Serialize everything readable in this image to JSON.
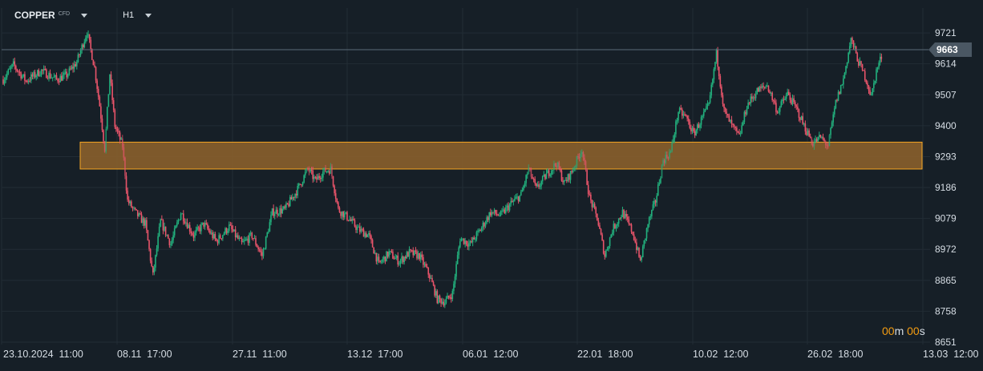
{
  "header": {
    "symbol": "COPPER",
    "symbol_type": "CFD",
    "timeframe": "H1"
  },
  "timer": {
    "minutes": "00",
    "m_unit": "m",
    "seconds": "00",
    "s_unit": "s"
  },
  "colors": {
    "background": "#161f27",
    "up": "#22b07d",
    "down": "#e8546a",
    "zone_fill": "#8a5f2c",
    "zone_border": "#f5a623",
    "price_line": "#5b6b78",
    "timer": "#f39c12"
  },
  "chart_data": {
    "type": "candlestick",
    "y_ticks": [
      9721,
      9614,
      9507,
      9400,
      9293,
      9186,
      9079,
      8972,
      8865,
      8758,
      8651
    ],
    "ylim": [
      8651,
      9755
    ],
    "x_tick_labels": [
      "23.10.2024  11:00",
      "08.11  17:00",
      "27.11  11:00",
      "13.12  17:00",
      "06.01  12:00",
      "22.01  18:00",
      "10.02  12:00",
      "26.02  18:00",
      "13.03  12:00"
    ],
    "current_price": 9663,
    "zone": {
      "low": 9250,
      "high": 9343
    },
    "price_path": [
      {
        "i": 0,
        "p": 9560
      },
      {
        "i": 8,
        "p": 9610
      },
      {
        "i": 18,
        "p": 9555
      },
      {
        "i": 30,
        "p": 9590
      },
      {
        "i": 42,
        "p": 9560
      },
      {
        "i": 50,
        "p": 9575
      },
      {
        "i": 58,
        "p": 9620
      },
      {
        "i": 66,
        "p": 9725
      },
      {
        "i": 72,
        "p": 9600
      },
      {
        "i": 76,
        "p": 9470
      },
      {
        "i": 80,
        "p": 9320
      },
      {
        "i": 84,
        "p": 9580
      },
      {
        "i": 88,
        "p": 9400
      },
      {
        "i": 94,
        "p": 9330
      },
      {
        "i": 98,
        "p": 9140
      },
      {
        "i": 104,
        "p": 9100
      },
      {
        "i": 112,
        "p": 9060
      },
      {
        "i": 118,
        "p": 8880
      },
      {
        "i": 124,
        "p": 9070
      },
      {
        "i": 132,
        "p": 8990
      },
      {
        "i": 140,
        "p": 9100
      },
      {
        "i": 150,
        "p": 9020
      },
      {
        "i": 158,
        "p": 9060
      },
      {
        "i": 168,
        "p": 9000
      },
      {
        "i": 178,
        "p": 9050
      },
      {
        "i": 188,
        "p": 8990
      },
      {
        "i": 196,
        "p": 9020
      },
      {
        "i": 204,
        "p": 8950
      },
      {
        "i": 212,
        "p": 9100
      },
      {
        "i": 222,
        "p": 9110
      },
      {
        "i": 232,
        "p": 9180
      },
      {
        "i": 240,
        "p": 9250
      },
      {
        "i": 246,
        "p": 9210
      },
      {
        "i": 252,
        "p": 9240
      },
      {
        "i": 258,
        "p": 9250
      },
      {
        "i": 264,
        "p": 9110
      },
      {
        "i": 272,
        "p": 9080
      },
      {
        "i": 280,
        "p": 9040
      },
      {
        "i": 288,
        "p": 9020
      },
      {
        "i": 296,
        "p": 8920
      },
      {
        "i": 304,
        "p": 8960
      },
      {
        "i": 312,
        "p": 8930
      },
      {
        "i": 320,
        "p": 8960
      },
      {
        "i": 328,
        "p": 8950
      },
      {
        "i": 336,
        "p": 8880
      },
      {
        "i": 342,
        "p": 8800
      },
      {
        "i": 348,
        "p": 8790
      },
      {
        "i": 354,
        "p": 8820
      },
      {
        "i": 360,
        "p": 9010
      },
      {
        "i": 368,
        "p": 8990
      },
      {
        "i": 376,
        "p": 9040
      },
      {
        "i": 384,
        "p": 9100
      },
      {
        "i": 392,
        "p": 9090
      },
      {
        "i": 400,
        "p": 9130
      },
      {
        "i": 408,
        "p": 9160
      },
      {
        "i": 414,
        "p": 9250
      },
      {
        "i": 420,
        "p": 9180
      },
      {
        "i": 428,
        "p": 9230
      },
      {
        "i": 436,
        "p": 9270
      },
      {
        "i": 442,
        "p": 9200
      },
      {
        "i": 448,
        "p": 9240
      },
      {
        "i": 456,
        "p": 9320
      },
      {
        "i": 462,
        "p": 9150
      },
      {
        "i": 468,
        "p": 9080
      },
      {
        "i": 474,
        "p": 8950
      },
      {
        "i": 480,
        "p": 9040
      },
      {
        "i": 488,
        "p": 9100
      },
      {
        "i": 496,
        "p": 9030
      },
      {
        "i": 502,
        "p": 8930
      },
      {
        "i": 508,
        "p": 9060
      },
      {
        "i": 514,
        "p": 9140
      },
      {
        "i": 520,
        "p": 9280
      },
      {
        "i": 526,
        "p": 9310
      },
      {
        "i": 532,
        "p": 9450
      },
      {
        "i": 538,
        "p": 9430
      },
      {
        "i": 544,
        "p": 9370
      },
      {
        "i": 550,
        "p": 9420
      },
      {
        "i": 556,
        "p": 9470
      },
      {
        "i": 562,
        "p": 9650
      },
      {
        "i": 568,
        "p": 9450
      },
      {
        "i": 574,
        "p": 9400
      },
      {
        "i": 580,
        "p": 9360
      },
      {
        "i": 586,
        "p": 9470
      },
      {
        "i": 594,
        "p": 9520
      },
      {
        "i": 602,
        "p": 9540
      },
      {
        "i": 610,
        "p": 9450
      },
      {
        "i": 618,
        "p": 9510
      },
      {
        "i": 626,
        "p": 9450
      },
      {
        "i": 632,
        "p": 9390
      },
      {
        "i": 638,
        "p": 9340
      },
      {
        "i": 644,
        "p": 9360
      },
      {
        "i": 650,
        "p": 9330
      },
      {
        "i": 656,
        "p": 9480
      },
      {
        "i": 662,
        "p": 9560
      },
      {
        "i": 668,
        "p": 9700
      },
      {
        "i": 674,
        "p": 9620
      },
      {
        "i": 680,
        "p": 9560
      },
      {
        "i": 684,
        "p": 9500
      },
      {
        "i": 688,
        "p": 9590
      },
      {
        "i": 692,
        "p": 9640
      }
    ]
  }
}
